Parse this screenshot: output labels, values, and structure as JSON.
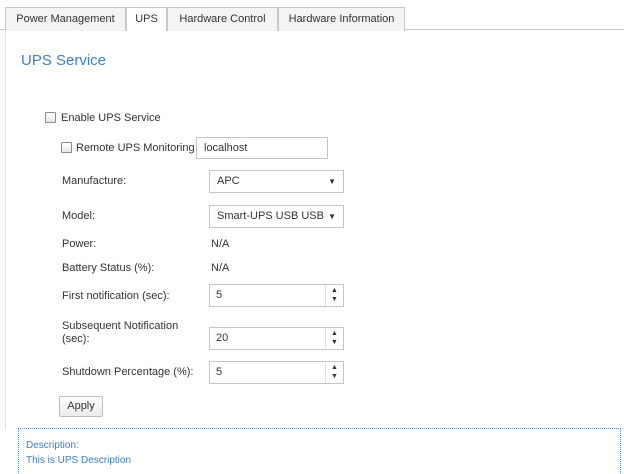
{
  "tabs": [
    {
      "label": "Power Management",
      "active": false
    },
    {
      "label": "UPS",
      "active": true
    },
    {
      "label": "Hardware Control",
      "active": false
    },
    {
      "label": "Hardware Information",
      "active": false
    }
  ],
  "section_title": "UPS Service",
  "enable_ups": {
    "label": "Enable UPS Service",
    "checked": false
  },
  "remote_monitoring": {
    "label": "Remote UPS Monitoring",
    "checked": false,
    "host_value": "localhost"
  },
  "manufacture": {
    "label": "Manufacture:",
    "selected": "APC"
  },
  "model": {
    "label": "Model:",
    "selected": "Smart-UPS USB USB"
  },
  "power": {
    "label": "Power:",
    "value": "N/A"
  },
  "battery_status": {
    "label": "Battery Status (%):",
    "value": "N/A"
  },
  "first_notification": {
    "label": "First notification (sec):",
    "value": "5"
  },
  "subsequent_notification": {
    "label_line1": "Subsequent Notification",
    "label_line2": "(sec):",
    "value": "20"
  },
  "shutdown_percentage": {
    "label": "Shutdown Percentage (%):",
    "value": "5"
  },
  "apply_label": "Apply",
  "description": {
    "heading": "Description:",
    "text": "This is UPS Description"
  },
  "colors": {
    "accent": "#3f7fbf",
    "border": "#c9c9c9",
    "dotted": "#5b9bd5"
  },
  "icons": {
    "dropdown": "caret-down-icon",
    "spinner_up": "spin-up-icon",
    "spinner_down": "spin-down-icon"
  }
}
